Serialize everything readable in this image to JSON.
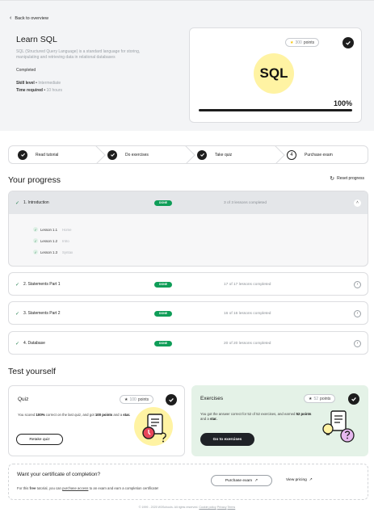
{
  "nav": {
    "back_label": "Back to overview"
  },
  "course": {
    "title": "Learn SQL",
    "description": "SQL (Structured Query Language) is a standard language for storing, manipulating and retrieving data in relational databases",
    "status": "Completed",
    "skill_label": "Skill level",
    "skill_value": "Intermediate",
    "time_label": "Time required",
    "time_value": "10 hours",
    "logo_text": "SQL",
    "points_count": "300",
    "points_label": "points",
    "progress_text": "100%",
    "progress_fraction": 1.0
  },
  "steps": [
    {
      "label": "Read tutorial",
      "done": true
    },
    {
      "label": "Do exercises",
      "done": true
    },
    {
      "label": "Take quiz",
      "done": true
    },
    {
      "label": "Purchase exam",
      "done": false,
      "number": "4"
    }
  ],
  "progress": {
    "title": "Your progress",
    "reset_label": "Reset progress",
    "chapters": [
      {
        "name": "1. Introduction",
        "badge": "DONE",
        "count": "3 of 3 lessons completed",
        "open": true,
        "lessons": [
          {
            "name": "Lesson 1.1",
            "sub": "Home"
          },
          {
            "name": "Lesson 1.2",
            "sub": "Intro"
          },
          {
            "name": "Lesson 1.3",
            "sub": "Syntax"
          }
        ]
      },
      {
        "name": "2. Statements Part 1",
        "badge": "DONE",
        "count": "17 of 17 lessons completed",
        "open": false
      },
      {
        "name": "3. Statements Part 2",
        "badge": "DONE",
        "count": "16 of 16 lessons completed",
        "open": false
      },
      {
        "name": "4. Database",
        "badge": "DONE",
        "count": "20 of 20 lessons completed",
        "open": false
      }
    ]
  },
  "test": {
    "title": "Test yourself",
    "quiz": {
      "title": "Quiz",
      "points_count": "100",
      "points_label": "points",
      "text_1": "You scored ",
      "score": "100%",
      "text_2": " correct on the last quiz, and got ",
      "points_bold": "100 points",
      "text_3": " and a ",
      "star_bold": "star.",
      "button": "Retake quiz"
    },
    "exercises": {
      "title": "Exercises",
      "points_count": "52",
      "points_label": "points",
      "text_1": "You got the answer correct for 52 of 52 exercises, and earned ",
      "points_bold": "52 points",
      "text_2": " and a ",
      "star_bold": "star.",
      "button": "Go to exercises"
    }
  },
  "certificate": {
    "title": "Want your certificate of completion?",
    "text_1": "For this ",
    "free_bold": "free",
    "text_2": " tutorial, you can ",
    "link": "purchase access",
    "text_3": " to an exam and earn a completion certificate!",
    "purchase_button": "Purchase exam",
    "pricing_link": "View pricing"
  },
  "footer": {
    "text": "© 1999 - 2025 W3Schools. All rights reserved.",
    "link_1": "Cookie policy",
    "link_2": "Privacy",
    "link_3": "Terms"
  },
  "colors": {
    "done_green": "#0f9d58",
    "exercise_bg": "#e4f2e7",
    "logo_yellow": "#fff3a3",
    "dark": "#1d1d1d"
  }
}
